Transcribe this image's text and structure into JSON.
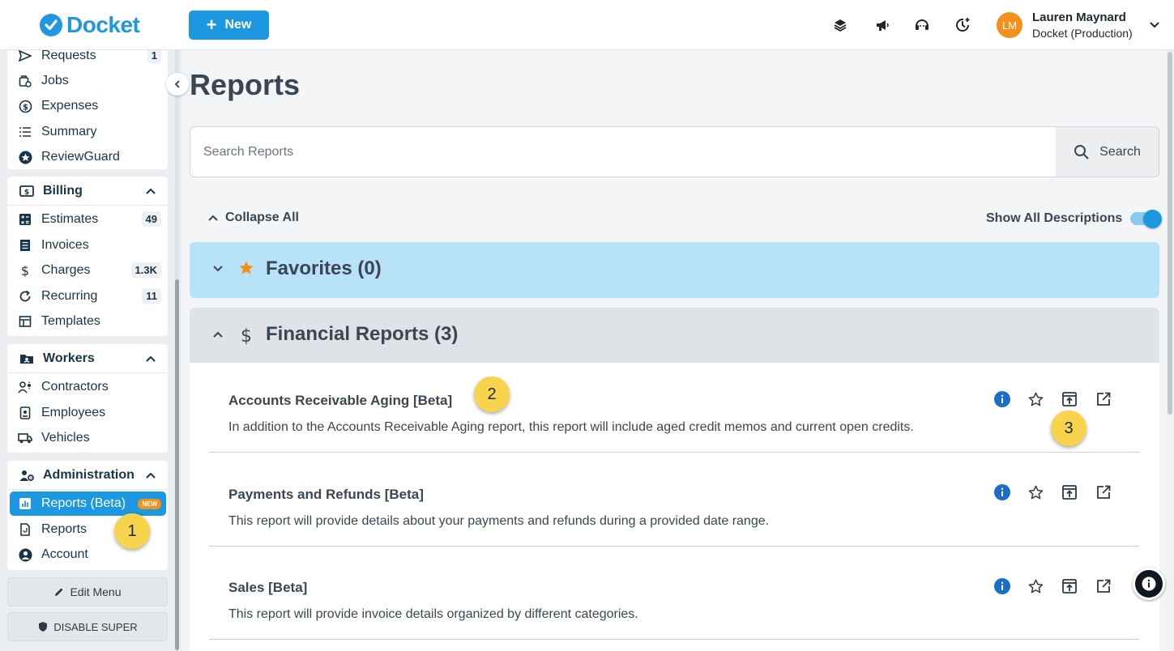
{
  "app": {
    "logo_text": "Docket",
    "new_label": "New"
  },
  "user": {
    "initials": "LM",
    "name": "Lauren Maynard",
    "org": "Docket (Production)"
  },
  "top_icons": [
    "layers-icon",
    "megaphone-icon",
    "headset-icon",
    "clock-plus-icon"
  ],
  "sidebar": {
    "top_items": [
      {
        "label": "Requests",
        "count": "1",
        "icon": "send-icon"
      },
      {
        "label": "Jobs",
        "icon": "job-icon"
      },
      {
        "label": "Expenses",
        "icon": "dollar-circle-icon"
      },
      {
        "label": "Summary",
        "icon": "list-icon"
      },
      {
        "label": "ReviewGuard",
        "icon": "star-circle-icon"
      }
    ],
    "billing": {
      "title": "Billing",
      "items": [
        {
          "label": "Estimates",
          "count": "49"
        },
        {
          "label": "Invoices"
        },
        {
          "label": "Charges",
          "count": "1.3K"
        },
        {
          "label": "Recurring",
          "count": "11"
        },
        {
          "label": "Templates"
        }
      ]
    },
    "workers": {
      "title": "Workers",
      "items": [
        {
          "label": "Contractors"
        },
        {
          "label": "Employees"
        },
        {
          "label": "Vehicles"
        }
      ]
    },
    "administration": {
      "title": "Administration",
      "items": [
        {
          "label": "Reports (Beta)",
          "badge": "NEW"
        },
        {
          "label": "Reports"
        },
        {
          "label": "Account"
        }
      ]
    },
    "edit_menu": "Edit Menu",
    "disable_super": "DISABLE SUPER"
  },
  "main": {
    "title": "Reports",
    "search": {
      "placeholder": "Search Reports",
      "button": "Search"
    },
    "collapse_all": "Collapse All",
    "show_all_descriptions": "Show All Descriptions",
    "show_all_descriptions_on": true,
    "groups": [
      {
        "title": "Favorites (0)",
        "expanded": false
      },
      {
        "title": "Financial Reports (3)",
        "expanded": true
      }
    ],
    "reports": [
      {
        "title": "Accounts Receivable Aging [Beta]",
        "description": "In addition to the Accounts Receivable Aging report, this report will include aged credit memos and current open credits."
      },
      {
        "title": "Payments and Refunds [Beta]",
        "description": "This report will provide details about your payments and refunds during a provided date range."
      },
      {
        "title": "Sales [Beta]",
        "description": "This report will provide invoice details organized by different categories."
      }
    ]
  },
  "markers": [
    "1",
    "2",
    "3"
  ],
  "colors": {
    "accent": "#1b98e0",
    "favorites_bg": "#b8e2f7",
    "badge": "#f2921d",
    "marker": "#f7d44c"
  }
}
